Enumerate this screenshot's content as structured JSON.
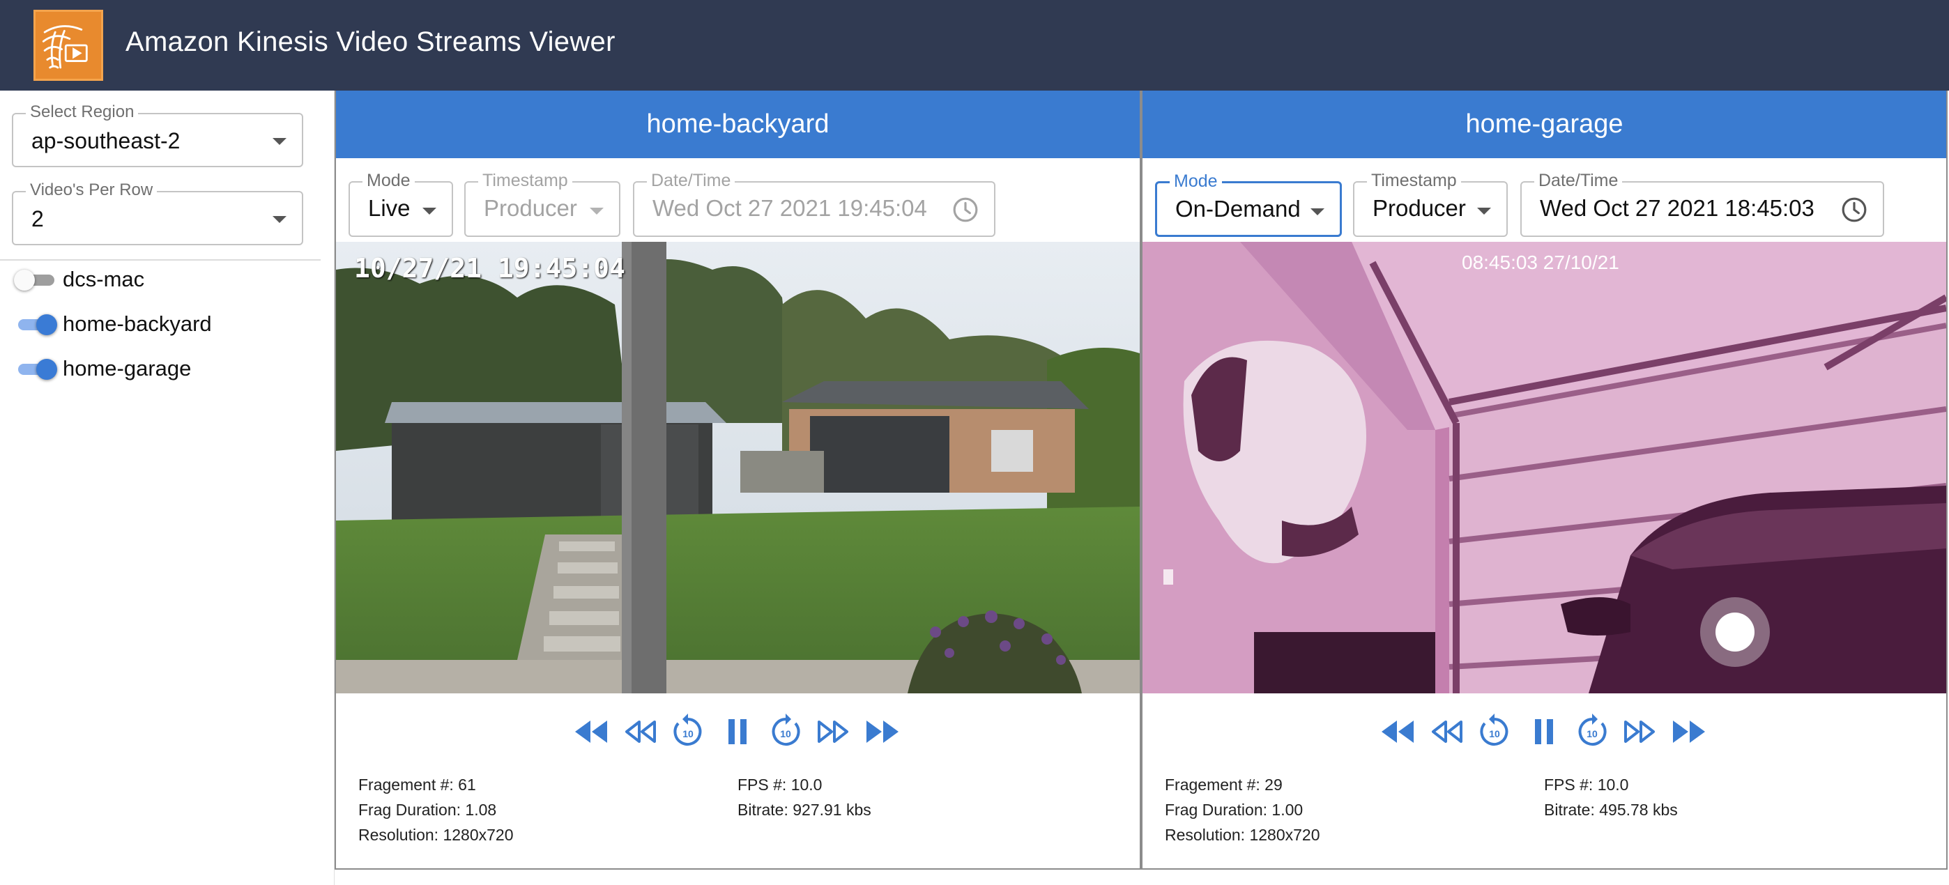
{
  "header": {
    "title": "Amazon Kinesis Video Streams Viewer",
    "logo_icon": "kinesis-video-logo",
    "background": "#303a52"
  },
  "sidebar": {
    "region": {
      "label": "Select Region",
      "value": "ap-southeast-2"
    },
    "per_row": {
      "label": "Video's Per Row",
      "value": "2"
    },
    "streams": [
      {
        "name": "dcs-mac",
        "enabled": false
      },
      {
        "name": "home-backyard",
        "enabled": true
      },
      {
        "name": "home-garage",
        "enabled": true
      }
    ]
  },
  "panels": [
    {
      "title": "home-backyard",
      "mode": {
        "label": "Mode",
        "value": "Live"
      },
      "timestamp": {
        "label": "Timestamp",
        "value": "Producer",
        "disabled": true
      },
      "datetime": {
        "label": "Date/Time",
        "value": "Wed Oct 27 2021 19:45:04",
        "disabled": true
      },
      "overlay": "10/27/21 19:45:04",
      "stats": {
        "fragment": "Fragement #: 61",
        "duration": "Frag Duration: 1.08",
        "resolution": "Resolution: 1280x720",
        "fps": "FPS #: 10.0",
        "bitrate": "Bitrate: 927.91 kbs"
      }
    },
    {
      "title": "home-garage",
      "mode": {
        "label": "Mode",
        "value": "On-Demand"
      },
      "timestamp": {
        "label": "Timestamp",
        "value": "Producer",
        "disabled": false
      },
      "datetime": {
        "label": "Date/Time",
        "value": "Wed Oct 27 2021 18:45:03",
        "disabled": false
      },
      "overlay": "08:45:03  27/10/21",
      "stats": {
        "fragment": "Fragement #: 29",
        "duration": "Frag Duration: 1.00",
        "resolution": "Resolution: 1280x720",
        "fps": "FPS #: 10.0",
        "bitrate": "Bitrate: 495.78 kbs"
      }
    }
  ],
  "playback_controls": [
    "seek-start-icon",
    "fast-rewind-icon",
    "replay-10-icon",
    "pause-icon",
    "forward-10-icon",
    "fast-forward-icon",
    "seek-end-icon"
  ],
  "colors": {
    "accent": "#3a7bd0",
    "header_bg": "#303a52",
    "logo": "#e88a2e"
  }
}
